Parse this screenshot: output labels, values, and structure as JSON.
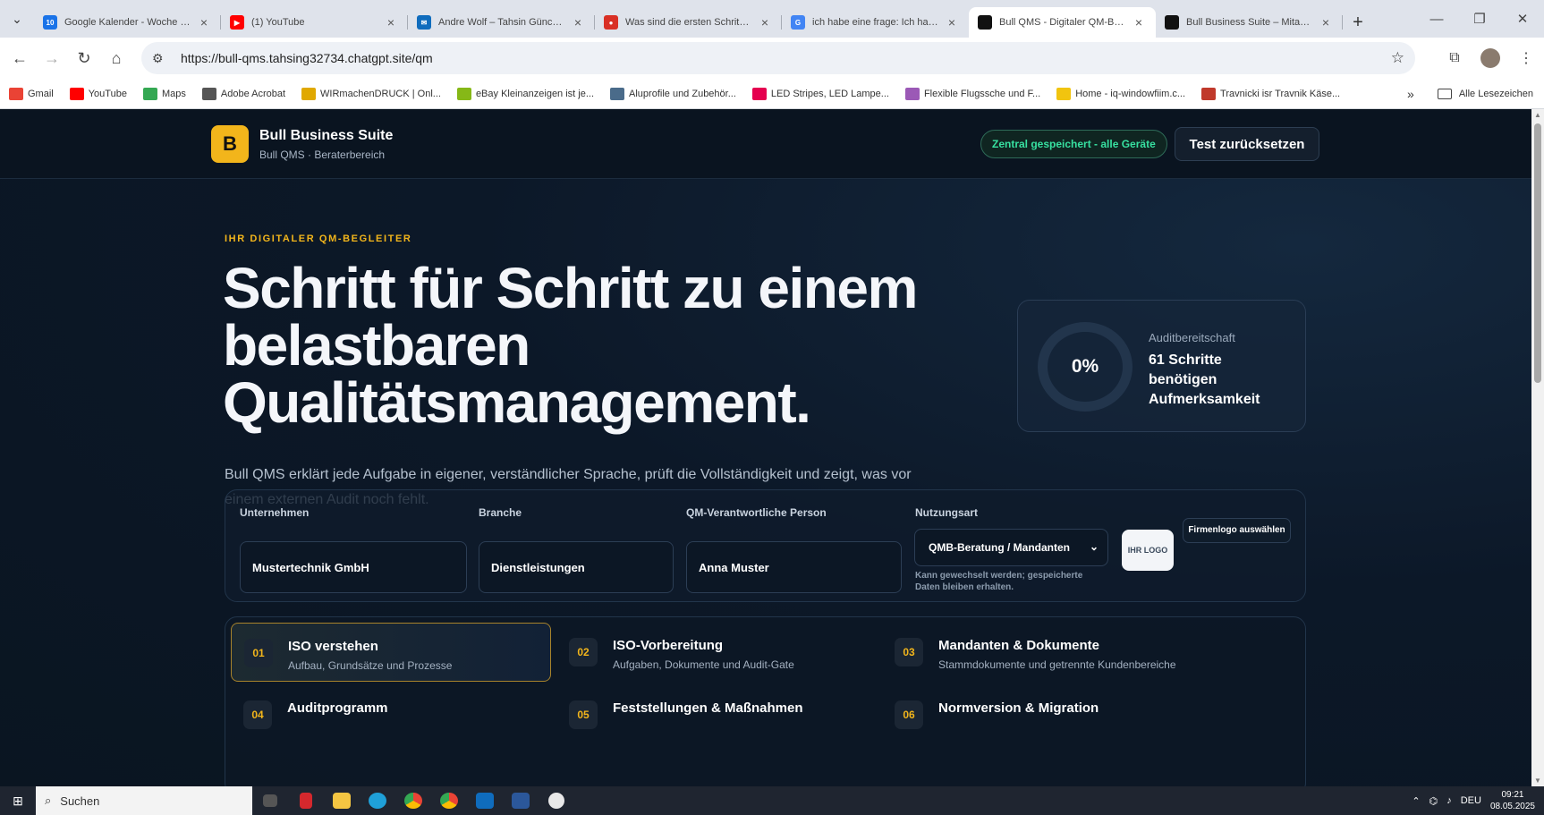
{
  "browser": {
    "tabs": [
      {
        "title": "Google Kalender - Woche vom",
        "favicon": "calendar-icon",
        "color": "#1a73e8",
        "badge": "10"
      },
      {
        "title": "(1) YouTube",
        "favicon": "youtube-icon",
        "color": "#ff0000",
        "badge": "▶"
      },
      {
        "title": "Andre Wolf – Tahsin Günce – C",
        "favicon": "outlook-icon",
        "color": "#0f6cbd",
        "badge": "✉"
      },
      {
        "title": "Was sind die ersten Schritte be",
        "favicon": "pin-icon",
        "color": "#d93025",
        "badge": "●"
      },
      {
        "title": "ich habe eine frage: Ich habe e",
        "favicon": "google-icon",
        "color": "#4285f4",
        "badge": "G"
      },
      {
        "title": "Bull QMS - Digitaler QM-Begle",
        "favicon": "site-icon",
        "color": "#111111",
        "badge": ""
      },
      {
        "title": "Bull Business Suite – Mitarbeit",
        "favicon": "site-icon",
        "color": "#111111",
        "badge": ""
      }
    ],
    "url": "https://bull-qms.tahsing32734.chatgpt.site/qm",
    "bookmarks": [
      {
        "label": "Gmail",
        "icon": "gmail-icon",
        "color": "#ea4335"
      },
      {
        "label": "YouTube",
        "icon": "youtube-icon",
        "color": "#ff0000"
      },
      {
        "label": "Maps",
        "icon": "maps-icon",
        "color": "#34a853"
      },
      {
        "label": "Adobe Acrobat",
        "icon": "acrobat-icon",
        "color": "#555555"
      },
      {
        "label": "WIRmachenDRUCK | Onl...",
        "icon": "print-icon",
        "color": "#e0a800"
      },
      {
        "label": "eBay Kleinanzeigen ist je...",
        "icon": "ebay-icon",
        "color": "#86b817"
      },
      {
        "label": "Aluprofile und Zubehör...",
        "icon": "globe-icon",
        "color": "#4a6b8a"
      },
      {
        "label": "LED Stripes, LED Lampe...",
        "icon": "led-icon",
        "color": "#e5004f"
      },
      {
        "label": "Flexible Flugssche und F...",
        "icon": "plane-icon",
        "color": "#9b59b6"
      },
      {
        "label": "Home - iq-windowfiim.c...",
        "icon": "eye-icon",
        "color": "#f1c40f"
      },
      {
        "label": "Travnicki isr Travnik Käse...",
        "icon": "cheese-icon",
        "color": "#c0392b"
      }
    ],
    "all_bookmarks": "Alle Lesezeichen"
  },
  "app": {
    "logo_letter": "B",
    "brand_name": "Bull Business Suite",
    "brand_sub": "Bull QMS · Beraterbereich",
    "sync_badge": "Zentral gespeichert - alle Geräte",
    "reset_button": "Test zurücksetzen"
  },
  "hero": {
    "eyebrow": "IHR DIGITALER QM-BEGLEITER",
    "headline": "Schritt für Schritt zu einem belastbaren Qualitätsmanagement.",
    "lead": "Bull QMS erklärt jede Aufgabe in eigener, verständlicher Sprache, prüft die Vollständigkeit und zeigt, was vor einem externen Audit noch fehlt."
  },
  "readiness": {
    "percent": "0%",
    "progress_value": 0,
    "label": "Auditbereitschaft",
    "value": "61 Schritte benötigen Aufmerksamkeit"
  },
  "form": {
    "company_label": "Unternehmen",
    "company_value": "Mustertechnik GmbH",
    "industry_label": "Branche",
    "industry_value": "Dienstleistungen",
    "person_label": "QM-Verantwortliche Person",
    "person_value": "Anna Muster",
    "usage_label": "Nutzungsart",
    "usage_value": "QMB-Beratung / Mandanten",
    "usage_hint": "Kann gewechselt werden; gespeicherte Daten bleiben erhalten.",
    "logo_placeholder": "IHR LOGO",
    "logo_button": "Firmenlogo auswählen"
  },
  "steps": [
    {
      "num": "01",
      "title": "ISO verstehen",
      "desc": "Aufbau, Grundsätze und Prozesse"
    },
    {
      "num": "02",
      "title": "ISO-Vorbereitung",
      "desc": "Aufgaben, Dokumente und Audit-Gate"
    },
    {
      "num": "03",
      "title": "Mandanten & Dokumente",
      "desc": "Stammdokumente und getrennte Kundenbereiche"
    },
    {
      "num": "04",
      "title": "Auditprogramm",
      "desc": ""
    },
    {
      "num": "05",
      "title": "Feststellungen & Maßnahmen",
      "desc": ""
    },
    {
      "num": "06",
      "title": "Normversion & Migration",
      "desc": ""
    }
  ],
  "taskbar": {
    "search": "Suchen",
    "lang": "DEU",
    "time": "09:21",
    "date": "08.05.2025"
  }
}
